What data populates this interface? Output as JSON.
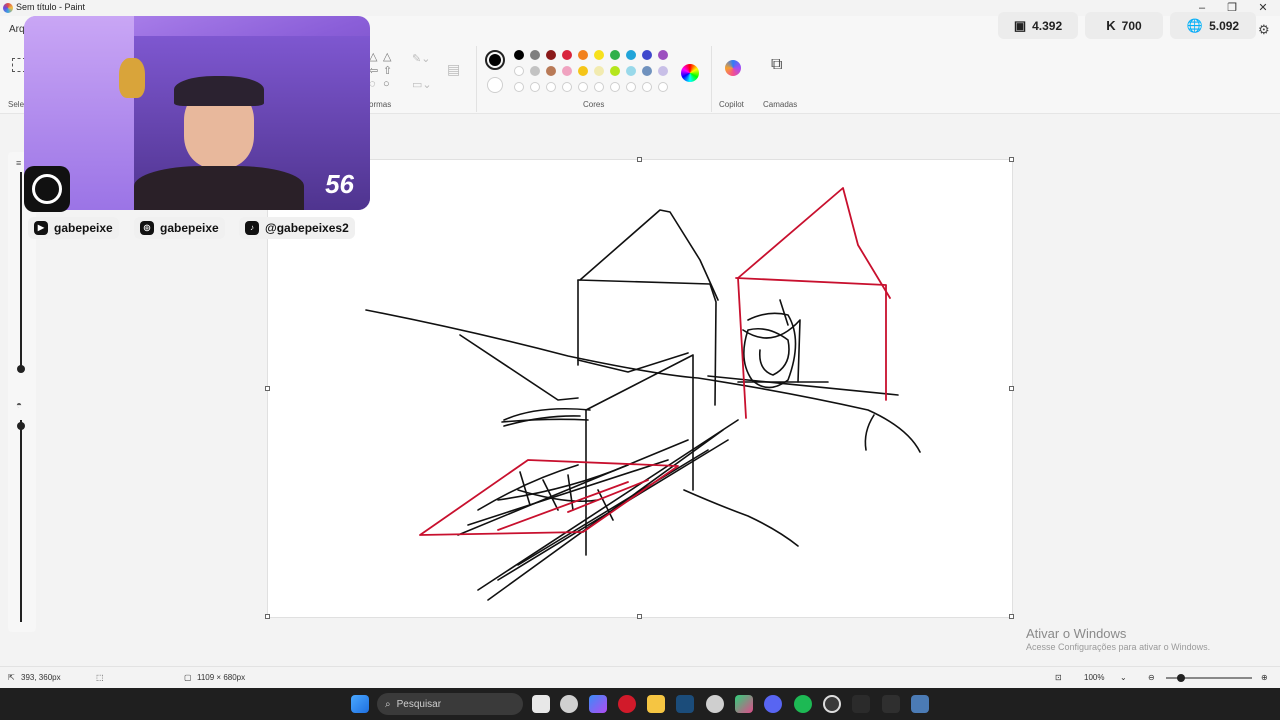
{
  "window": {
    "title": "Sem título - Paint"
  },
  "menu": {
    "file_label": "Arq",
    "select_label": "Sele"
  },
  "ribbon": {
    "shapes_label": "ormas",
    "colors_label": "Cores",
    "copilot_label": "Copilot",
    "layers_label": "Camadas",
    "palette": [
      "#000000",
      "#7f7f7f",
      "#8b1a1a",
      "#d8243c",
      "#f2811d",
      "#f7e11c",
      "#2fb04a",
      "#21a4d9",
      "#3f48cc",
      "#9c4fbf",
      "#ffffff",
      "#c3c3c3",
      "#b97a57",
      "#f0a3c0",
      "#f5c518",
      "#f2ebb0",
      "#b5e61d",
      "#99d9ea",
      "#7092be",
      "#c8bfe7"
    ],
    "current_color": "#000000"
  },
  "stats": {
    "twitch": "4.392",
    "kick": "700",
    "total": "5.092"
  },
  "stream_overlay": {
    "viewer_count": "56",
    "socials": [
      "gabepeixe",
      "gabepeixe",
      "@gabepeixes2"
    ]
  },
  "statusbar": {
    "cursor_position": "393, 360px",
    "canvas_size": "1109 × 680px",
    "zoom": "100%"
  },
  "watermark": {
    "title": "Ativar o Windows",
    "subtitle": "Acesse Configurações para ativar o Windows."
  },
  "taskbar": {
    "search_placeholder": "Pesquisar"
  },
  "colors": {
    "drawing_black": "#111111",
    "drawing_red": "#c8102e",
    "webcam_bg": "#8a5ed8"
  }
}
